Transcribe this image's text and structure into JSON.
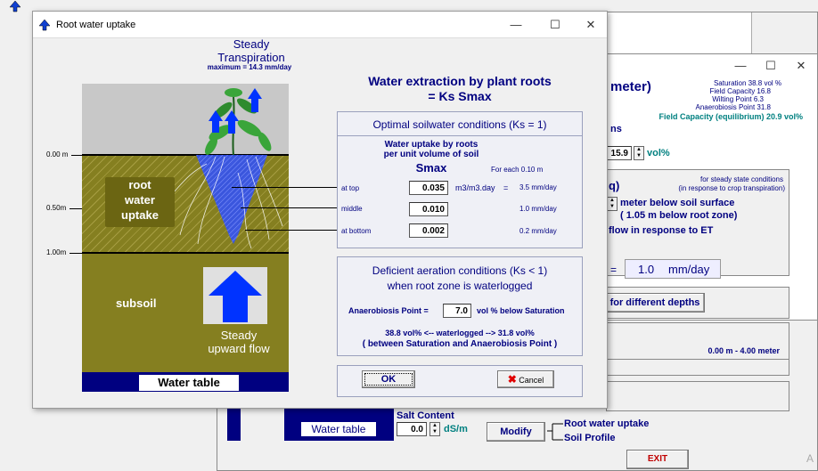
{
  "back_window": {
    "app_icon": "up-arrow-icon",
    "panel_title_suffix": "meter)",
    "soil": {
      "saturation": "Saturation  38.8  vol %",
      "field_capacity": "Field Capacity  16.8",
      "wilting_point": "Wilting Point   6.3",
      "anaerobiosis_point": "Anaerobiosis Point  31.8",
      "fc_equilibrium": "Field Capacity (equilibrium) 20.9 vol%"
    },
    "ns_label": "ns",
    "vol_value": "15.9",
    "vol_unit": "vol%",
    "q_label": "q)",
    "steady_note_1": "for steady state conditions",
    "steady_note_2": "(in response to crop transpiration)",
    "below_surface": "meter below soil surface",
    "below_root_zone": "( 1.05 m below root zone)",
    "flow_response": "flow in response to ET",
    "eq_sign": "=",
    "flow_value": "1.0",
    "flow_unit": "mm/day",
    "depths_button": "for different depths",
    "depth_range": "0.00 m -  4.00 meter",
    "water_table": "Water table",
    "salt_content_label": "Salt Content",
    "salt_value": "0.0",
    "salt_unit": "dS/m",
    "modify_button": "Modify",
    "modify_option_1": "Root water uptake",
    "modify_option_2": "Soil Profile",
    "exit_button": "EXIT",
    "side_letter": "A"
  },
  "dialog": {
    "title": "Root water uptake",
    "app_icon": "up-arrow-icon",
    "controls": {
      "minimize": "—",
      "maximize": "☐",
      "close": "✕"
    },
    "diagram": {
      "steady": "Steady",
      "transpiration": "Transpiration",
      "maximum": "maximum =   14.3 mm/day",
      "depth_0": "0.00 m",
      "depth_05": "0.50m",
      "depth_1": "1.00m",
      "root_zone_lines": [
        "root",
        "water",
        "uptake"
      ],
      "subsoil": "subsoil",
      "steady_flow_1": "Steady",
      "steady_flow_2": "upward flow",
      "water_table": "Water table"
    },
    "heading_1": "Water extraction by plant roots",
    "heading_2": "= Ks  Smax",
    "optimal": {
      "title": "Optimal soilwater conditions (Ks = 1)",
      "uptake_1": "Water uptake by roots",
      "uptake_2": "per unit volume of soil",
      "smax": "Smax",
      "each": "For each 0.10 m",
      "rows": [
        {
          "label": "at top",
          "value": "0.035",
          "unit": "m3/m3.day",
          "eq": "=",
          "mm": "3.5 mm/day"
        },
        {
          "label": "middle",
          "value": "0.010",
          "unit": "",
          "eq": "",
          "mm": "1.0 mm/day"
        },
        {
          "label": "at bottom",
          "value": "0.002",
          "unit": "",
          "eq": "",
          "mm": "0.2 mm/day"
        }
      ]
    },
    "deficient": {
      "title_1": "Deficient aeration conditions (Ks < 1)",
      "title_2": "when root zone is waterlogged",
      "anaero_label": "Anaerobiosis Point  =",
      "anaero_value": "7.0",
      "anaero_unit": "vol %  below Saturation",
      "range_line": "38.8 vol% <-- waterlogged --> 31.8 vol%",
      "between_line": "( between Saturation and Anaerobiosis Point )"
    },
    "ok_button": "OK",
    "cancel_button": "Cancel",
    "cancel_icon": "red-x-icon"
  },
  "colors": {
    "navy": "#000080",
    "olive": "#857f20",
    "teal": "#008080",
    "arrow": "#0033ff"
  }
}
